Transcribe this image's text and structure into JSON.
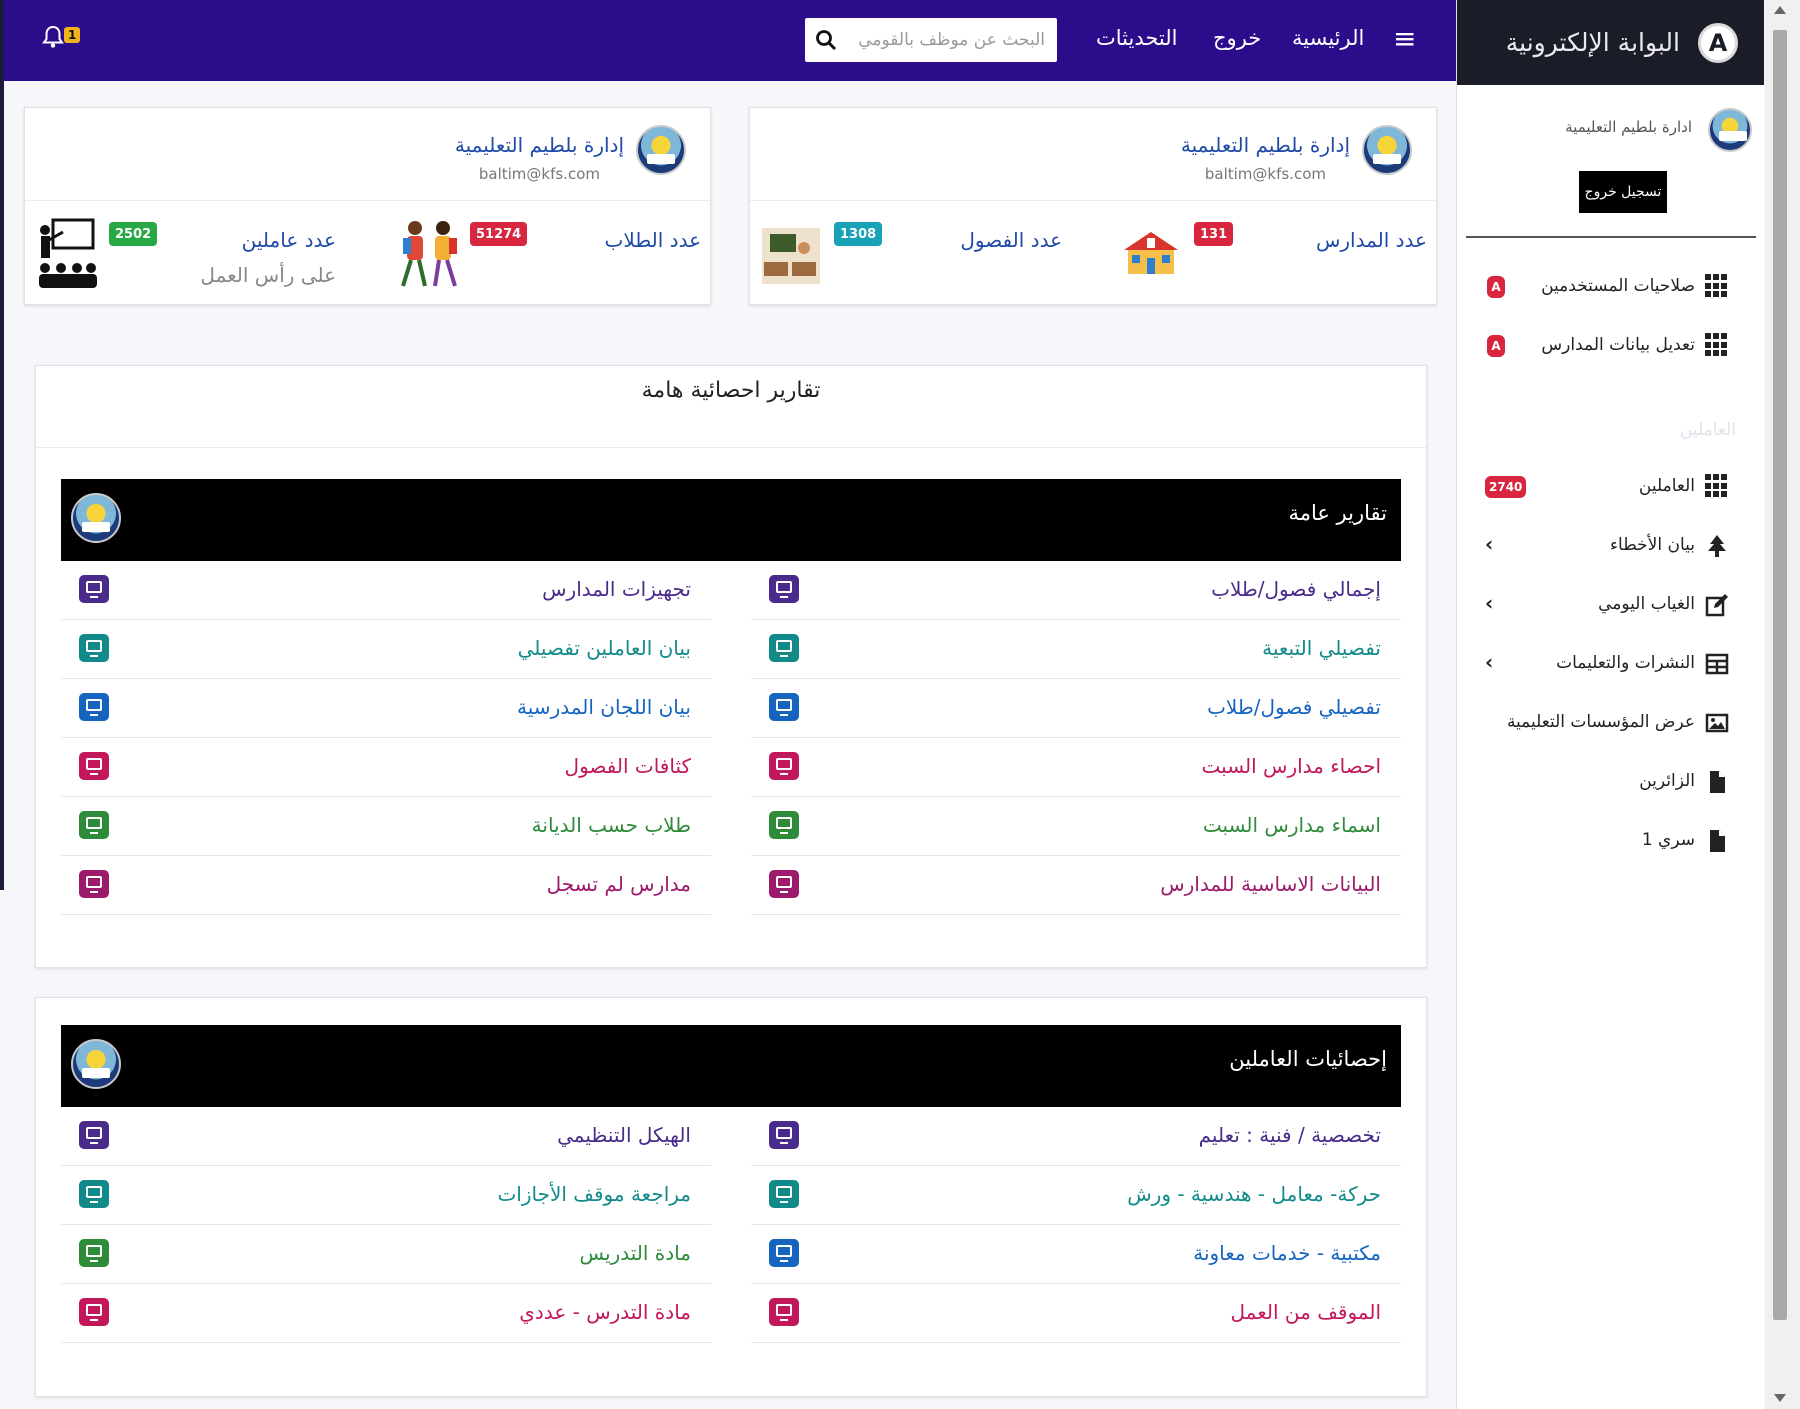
{
  "app": {
    "brand": "البوابة الإلكترونية",
    "brand_logo": "A"
  },
  "topbar": {
    "menu_icon": "hamburger-icon",
    "links": [
      "الرئيسية",
      "خروج",
      "التحديثات"
    ],
    "search_placeholder": "البحث عن موظف بالقومي",
    "search_icon": "search-icon",
    "notifications_count": "1",
    "bar_color": "#2b0d8c"
  },
  "sidebar": {
    "user_name": "ادارة بلطيم التعليمية",
    "logout_label": "تسجيل خروج",
    "section_label": "العاملين",
    "items": [
      {
        "label": "صلاحيات المستخدمين",
        "icon": "grid-icon",
        "badge": "A"
      },
      {
        "label": "تعديل بيانات المدارس",
        "icon": "grid-icon",
        "badge": "A"
      },
      {
        "label": "العاملين",
        "icon": "grid-icon",
        "badge": "2740"
      },
      {
        "label": "بيان الأخطاء",
        "icon": "tree-icon"
      },
      {
        "label": "الغياب اليومي",
        "icon": "edit-icon"
      },
      {
        "label": "النشرات والتعليمات",
        "icon": "table-icon"
      },
      {
        "label": "عرض المؤسسات التعليمية",
        "icon": "image-icon"
      },
      {
        "label": "الزائرين",
        "icon": "file-icon"
      },
      {
        "label": "سري 1",
        "icon": "file-icon"
      }
    ]
  },
  "cards": [
    {
      "title": "إدارة بلطيم التعليمية",
      "email": "baltim@kfs.com",
      "stats": [
        {
          "label": "عدد المدارس",
          "value": "131",
          "icon": "school-building-icon"
        },
        {
          "label": "عدد الفصول",
          "value": "1308",
          "icon": "classroom-icon"
        }
      ]
    },
    {
      "title": "إدارة بلطيم التعليمية",
      "email": "baltim@kfs.com",
      "stats": [
        {
          "label": "عدد الطلاب",
          "value": "51274",
          "icon": "students-icon"
        },
        {
          "label": "عدد عاملين",
          "sub": "على رأس العمل",
          "value": "2502",
          "icon": "teacher-class-icon"
        }
      ]
    }
  ],
  "reports": {
    "title": "تقارير احصائية هامة",
    "general": {
      "title": "تقارير عامة",
      "right": [
        "إجمالي فصول/طلاب",
        "تفصيلي التبعية",
        "تفصيلي فصول/طلاب",
        "احصاء مدارس السبت",
        "اسماء مدارس السبت",
        "البيانات الاساسية للمدارس"
      ],
      "left": [
        "تجهيزات المدارس",
        "بيان العاملين تفصيلي",
        "بيان اللجان المدرسية",
        "كثافات الفصول",
        "طلاب حسب الديانة",
        "مدارس لم تسجل"
      ]
    },
    "staff": {
      "title": "إحصائيات العاملين",
      "right": [
        "تخصصية / فنية : تعليم",
        "حركة- معامل - هندسية - ورش",
        "مكتبية - خدمات معاونة",
        "الموقف من العمل"
      ],
      "left": [
        "الهيكل التنظيمي",
        "مراجعة موقف الأجازات",
        "مادة التدريس",
        "مادة التدرس - عددي"
      ]
    },
    "row_colors": [
      "#4a2b8c",
      "#138a8a",
      "#1565c0",
      "#c2185b",
      "#2e8b3a",
      "#9c1b6b"
    ],
    "staff_colors": [
      "#4a2b8c",
      "#138a8a",
      "#1565c0",
      "#c2185b"
    ],
    "staff_left_colors": [
      "#4a2b8c",
      "#138a8a",
      "#2e8b3a",
      "#c2185b"
    ]
  }
}
